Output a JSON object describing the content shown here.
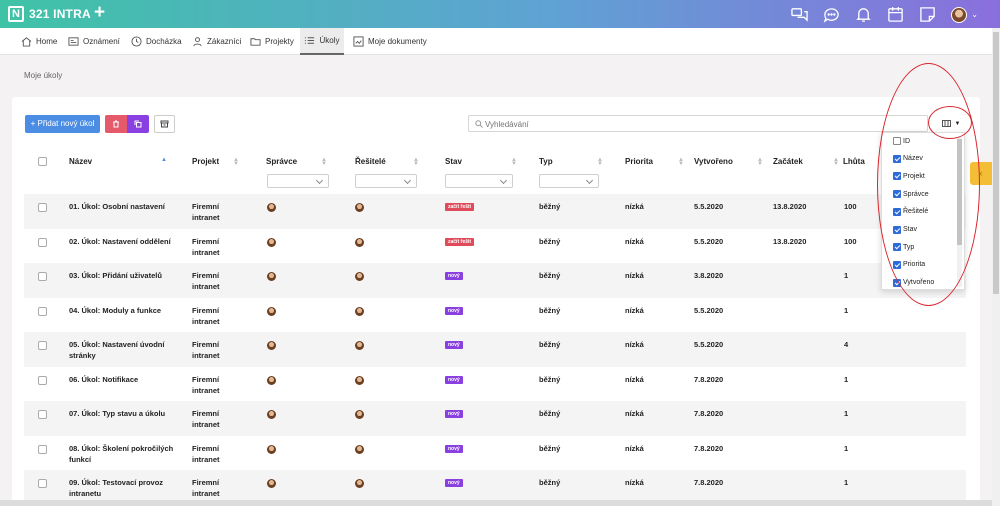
{
  "app": {
    "logo_letter": "N",
    "name": "321 INTRA",
    "add_label": "+"
  },
  "nav": [
    {
      "label": "Home",
      "icon": "home-icon"
    },
    {
      "label": "Oznámení",
      "icon": "news-icon"
    },
    {
      "label": "Docházka",
      "icon": "clock-icon"
    },
    {
      "label": "Zákazníci",
      "icon": "people-icon"
    },
    {
      "label": "Projekty",
      "icon": "folder-icon"
    },
    {
      "label": "Úkoly",
      "icon": "tasks-icon"
    },
    {
      "label": "Moje dokumenty",
      "icon": "document-icon"
    }
  ],
  "breadcrumb": "Moje úkoly",
  "toolbar": {
    "add_label": "+ Přidat nový úkol",
    "search_placeholder": "Vyhledávání"
  },
  "table": {
    "headers": [
      "Název",
      "Projekt",
      "Správce",
      "Řešitelé",
      "Stav",
      "Typ",
      "Priorita",
      "Vytvořeno",
      "Začátek",
      "Lhůta"
    ],
    "rows": [
      {
        "name": [
          "01. Úkol: Osobní nastavení",
          ""
        ],
        "project": [
          "Firemní",
          "intranet"
        ],
        "status": "začít řešit",
        "status_color": "#e04b5c",
        "type": "běžný",
        "priority": "nízká",
        "created": "5.5.2020",
        "start": "13.8.2020",
        "deadline": "100"
      },
      {
        "name": [
          "02. Úkol: Nastavení oddělení",
          ""
        ],
        "project": [
          "Firemní",
          "intranet"
        ],
        "status": "začít řešit",
        "status_color": "#e04b5c",
        "type": "běžný",
        "priority": "nízká",
        "created": "5.5.2020",
        "start": "13.8.2020",
        "deadline": "100"
      },
      {
        "name": [
          "03. Úkol: Přidání uživatelů",
          ""
        ],
        "project": [
          "Firemní",
          "intranet"
        ],
        "status": "nový",
        "status_color": "#8a3fe0",
        "type": "běžný",
        "priority": "nízká",
        "created": "3.8.2020",
        "start": "",
        "deadline": "1"
      },
      {
        "name": [
          "04. Úkol: Moduly a funkce",
          ""
        ],
        "project": [
          "Firemní",
          "intranet"
        ],
        "status": "nový",
        "status_color": "#8a3fe0",
        "type": "běžný",
        "priority": "nízká",
        "created": "5.5.2020",
        "start": "",
        "deadline": "1"
      },
      {
        "name": [
          "05. Úkol: Nastavení úvodní",
          "stránky"
        ],
        "project": [
          "Firemní",
          "intranet"
        ],
        "status": "nový",
        "status_color": "#8a3fe0",
        "type": "běžný",
        "priority": "nízká",
        "created": "5.5.2020",
        "start": "",
        "deadline": "4"
      },
      {
        "name": [
          "06. Úkol: Notifikace",
          ""
        ],
        "project": [
          "Firemní",
          "intranet"
        ],
        "status": "nový",
        "status_color": "#8a3fe0",
        "type": "běžný",
        "priority": "nízká",
        "created": "7.8.2020",
        "start": "",
        "deadline": "1"
      },
      {
        "name": [
          "07. Úkol: Typ stavu a úkolu",
          ""
        ],
        "project": [
          "Firemní",
          "intranet"
        ],
        "status": "nový",
        "status_color": "#8a3fe0",
        "type": "běžný",
        "priority": "nízká",
        "created": "7.8.2020",
        "start": "",
        "deadline": "1"
      },
      {
        "name": [
          "08. Úkol: Školení pokročilých",
          "funkcí"
        ],
        "project": [
          "Firemní",
          "intranet"
        ],
        "status": "nový",
        "status_color": "#8a3fe0",
        "type": "běžný",
        "priority": "nízká",
        "created": "7.8.2020",
        "start": "",
        "deadline": "1"
      },
      {
        "name": [
          "09. Úkol: Testovací provoz",
          "intranetu"
        ],
        "project": [
          "Firemní",
          "intranet"
        ],
        "status": "nový",
        "status_color": "#8a3fe0",
        "type": "běžný",
        "priority": "nízká",
        "created": "7.8.2020",
        "start": "",
        "deadline": "1"
      }
    ]
  },
  "column_menu": [
    {
      "label": "ID",
      "checked": false
    },
    {
      "label": "Název",
      "checked": true
    },
    {
      "label": "Projekt",
      "checked": true
    },
    {
      "label": "Správce",
      "checked": true
    },
    {
      "label": "Řešitelé",
      "checked": true
    },
    {
      "label": "Stav",
      "checked": true
    },
    {
      "label": "Typ",
      "checked": true
    },
    {
      "label": "Priorita",
      "checked": true
    },
    {
      "label": "Vytvořeno",
      "checked": true
    }
  ],
  "colors": {
    "accent": "#4b8de4",
    "danger": "#e55a6a",
    "purple": "#8a3fe0",
    "annotation": "#d9252c"
  }
}
